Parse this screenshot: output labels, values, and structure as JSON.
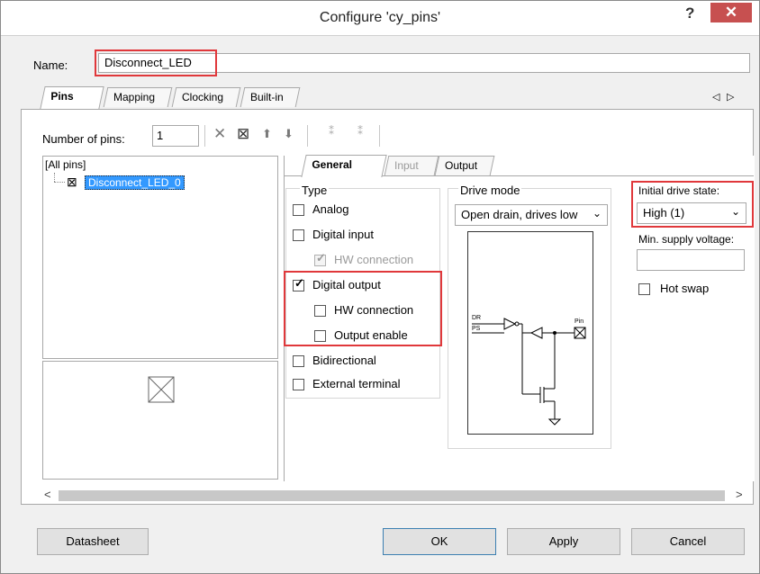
{
  "window": {
    "title": "Configure 'cy_pins'",
    "help": "?",
    "close": "✕"
  },
  "name": {
    "label": "Name:",
    "value": "Disconnect_LED"
  },
  "tabs": [
    {
      "label": "Pins"
    },
    {
      "label": "Mapping"
    },
    {
      "label": "Clocking"
    },
    {
      "label": "Built-in"
    }
  ],
  "tab_nav": {
    "left": "◁",
    "right": "▷"
  },
  "toolbar": {
    "pins_label": "Number of pins:",
    "pins_value": "1"
  },
  "tree": {
    "root": "[All pins]",
    "item": "Disconnect_LED_0"
  },
  "inner_tabs": [
    {
      "label": "General"
    },
    {
      "label": "Input"
    },
    {
      "label": "Output"
    }
  ],
  "type_group": {
    "title": "Type",
    "analog": "Analog",
    "digital_input": "Digital input",
    "hw_connection_in": "HW connection",
    "digital_output": "Digital output",
    "hw_connection_out": "HW connection",
    "output_enable": "Output enable",
    "bidirectional": "Bidirectional",
    "external_terminal": "External terminal"
  },
  "drive_mode": {
    "title": "Drive mode",
    "value": "Open drain, drives low"
  },
  "diagram": {
    "dr": "DR",
    "ps": "PS",
    "pin": "Pin"
  },
  "initial_drive": {
    "label": "Initial drive state:",
    "value": "High (1)"
  },
  "min_supply": {
    "label": "Min. supply voltage:",
    "value": ""
  },
  "hot_swap": {
    "label": "Hot swap"
  },
  "scroll": {
    "left": "<",
    "right": ">"
  },
  "buttons": {
    "datasheet": "Datasheet",
    "ok": "OK",
    "apply": "Apply",
    "cancel": "Cancel"
  },
  "colors": {
    "highlight": "#e0383b",
    "close_bg": "#c75050",
    "selection": "#3399ff"
  }
}
